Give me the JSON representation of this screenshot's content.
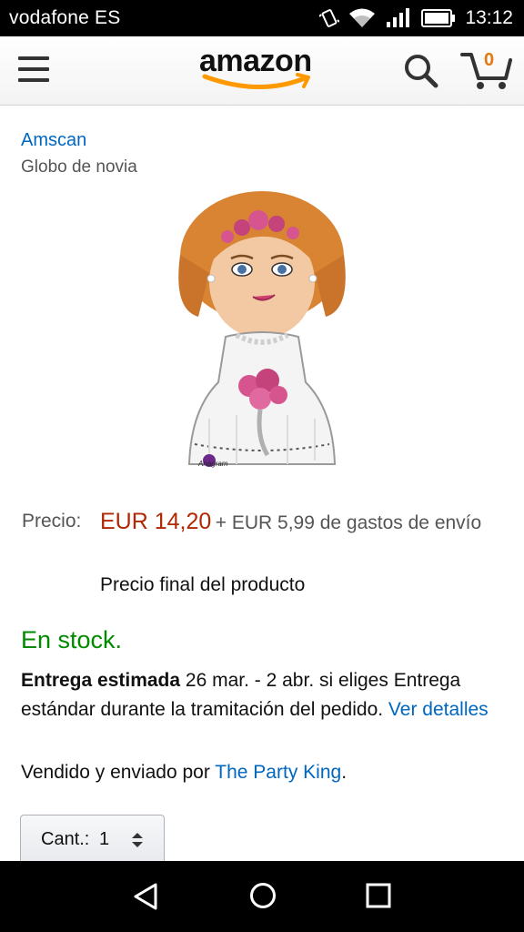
{
  "status_bar": {
    "carrier": "vodafone ES",
    "time": "13:12",
    "icons": [
      "vibrate-icon",
      "wifi-icon",
      "signal-icon",
      "battery-icon"
    ]
  },
  "header": {
    "logo": "amazon",
    "cart_count": "0",
    "icons": [
      "menu-icon",
      "search-icon",
      "cart-icon"
    ]
  },
  "product": {
    "brand": "Amscan",
    "title": "Globo de novia",
    "image_label": "Anagram"
  },
  "pricing": {
    "label": "Precio:",
    "price": "EUR 14,20",
    "shipping": "+ EUR 5,99 de gastos de envío",
    "final_note": "Precio final del producto"
  },
  "availability": {
    "stock": "En stock.",
    "delivery_bold": "Entrega estimada",
    "delivery_text": " 26 mar. - 2 abr. si eliges Entrega estándar durante la tramitación del pedido. ",
    "delivery_link": "Ver detalles",
    "seller_prefix": "Vendido y enviado por ",
    "seller_name": "The Party King",
    "seller_suffix": "."
  },
  "quantity": {
    "label": "Cant.:",
    "value": "1"
  },
  "nav_bar": {
    "icons": [
      "back-icon",
      "home-icon",
      "recent-apps-icon"
    ]
  },
  "colors": {
    "link": "#0066c0",
    "price": "#b12704",
    "stock": "#008a00",
    "cart_count": "#e47911",
    "logo_smile": "#ff9900"
  }
}
